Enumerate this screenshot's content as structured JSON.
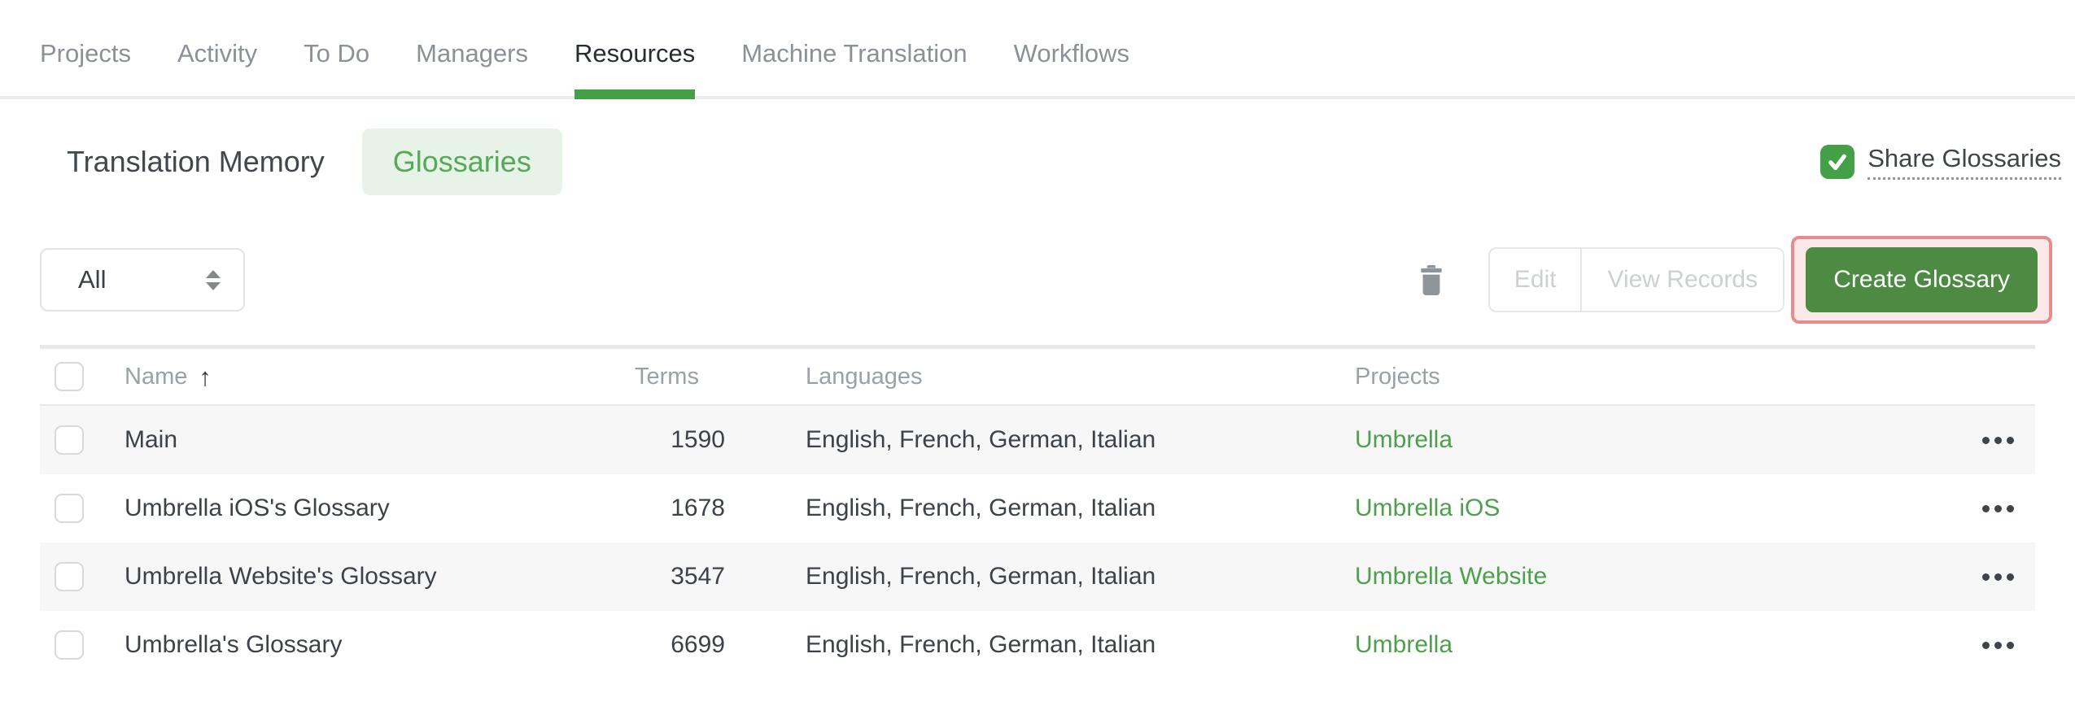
{
  "nav": {
    "tabs": [
      {
        "label": "Projects",
        "active": false
      },
      {
        "label": "Activity",
        "active": false
      },
      {
        "label": "To Do",
        "active": false
      },
      {
        "label": "Managers",
        "active": false
      },
      {
        "label": "Resources",
        "active": true
      },
      {
        "label": "Machine Translation",
        "active": false
      },
      {
        "label": "Workflows",
        "active": false
      }
    ]
  },
  "subnav": {
    "tabs": [
      {
        "label": "Translation Memory",
        "active": false
      },
      {
        "label": "Glossaries",
        "active": true
      }
    ],
    "share_glossaries": {
      "label": "Share Glossaries",
      "checked": true
    }
  },
  "toolbar": {
    "filter": {
      "value": "All"
    },
    "delete_icon": "trash-icon",
    "edit_label": "Edit",
    "view_records_label": "View Records",
    "edit_enabled": false,
    "view_records_enabled": false,
    "create_glossary_label": "Create Glossary",
    "create_glossary_highlighted": true
  },
  "table": {
    "columns": {
      "name": "Name",
      "terms": "Terms",
      "languages": "Languages",
      "projects": "Projects"
    },
    "sort": {
      "column": "Name",
      "direction": "ascending",
      "icon": "up-arrow"
    },
    "rows": [
      {
        "name": "Main",
        "terms": "1590",
        "languages": "English, French, German, Italian",
        "project": "Umbrella"
      },
      {
        "name": "Umbrella iOS's Glossary",
        "terms": "1678",
        "languages": "English, French, German, Italian",
        "project": "Umbrella iOS"
      },
      {
        "name": "Umbrella Website's Glossary",
        "terms": "3547",
        "languages": "English, French, German, Italian",
        "project": "Umbrella Website"
      },
      {
        "name": "Umbrella's Glossary",
        "terms": "6699",
        "languages": "English, French, German, Italian",
        "project": "Umbrella"
      }
    ]
  },
  "colors": {
    "accent_green": "#43a047",
    "button_green": "#4d8b43",
    "link_green": "#4da04d",
    "pill_bg": "#e7f3e6",
    "pill_text": "#56a956",
    "highlight_border": "#e98b8b",
    "highlight_bg": "#fbe9e9",
    "row_alt_bg": "#f7f7f8"
  }
}
